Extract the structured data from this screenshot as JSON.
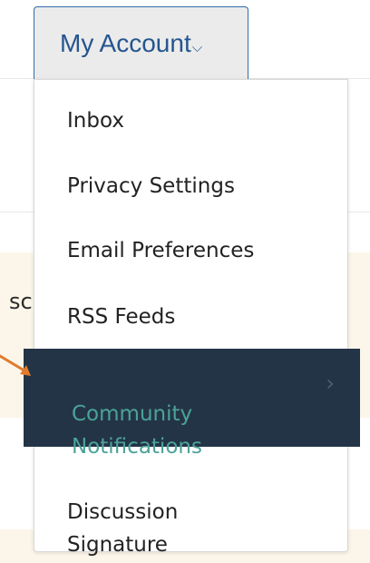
{
  "account_button": {
    "label": "My Account",
    "chevron": "⌵"
  },
  "background": {
    "partial_text": "sc"
  },
  "menu": {
    "items": [
      {
        "label": "Inbox"
      },
      {
        "label": "Privacy Settings"
      },
      {
        "label": "Email Preferences"
      },
      {
        "label": "RSS Feeds"
      },
      {
        "label": "Community\nNotifications",
        "active": true,
        "caret": "›"
      },
      {
        "label": "Discussion\nSignature"
      }
    ]
  },
  "colors": {
    "button_text": "#24558f",
    "active_bg": "#243447",
    "active_text": "#4aa39a",
    "arrow": "#e07a2e"
  },
  "icons": {
    "chevron": "chevron-down-icon",
    "caret": "chevron-right-icon",
    "pointer": "arrow-pointer-icon"
  }
}
